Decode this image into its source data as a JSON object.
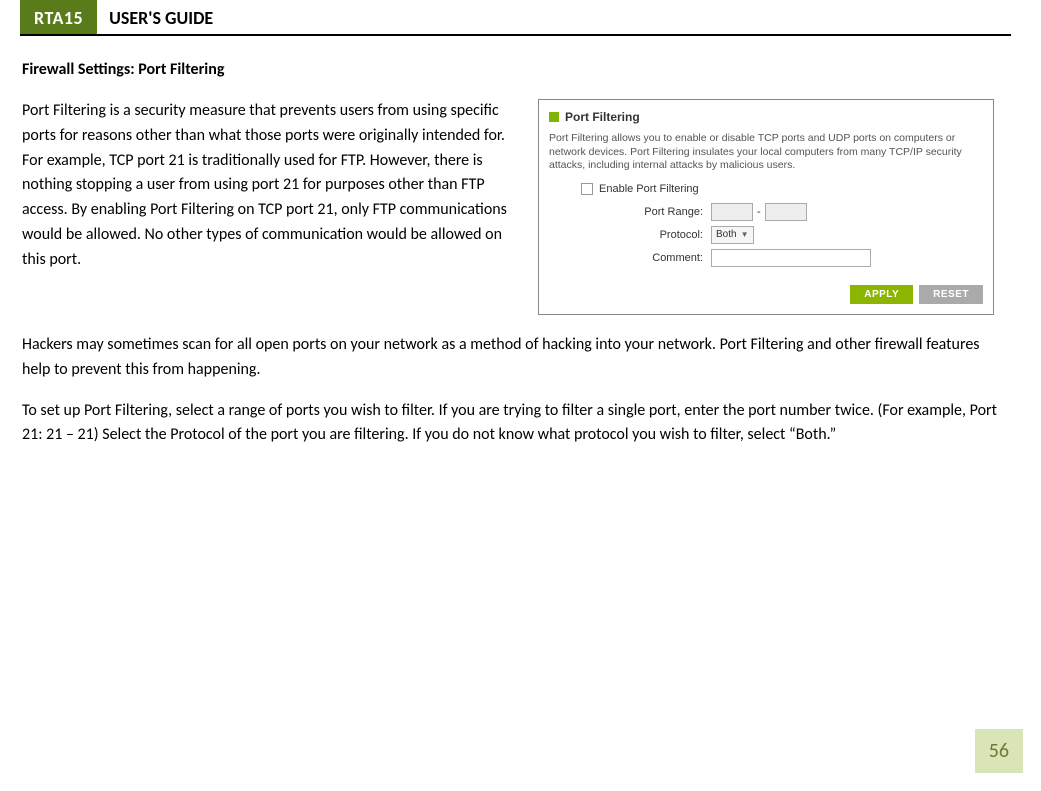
{
  "header": {
    "product": "RTA15",
    "title": "USER'S GUIDE"
  },
  "section_heading": "Firewall Settings: Port Filtering",
  "paragraphs": {
    "p1": "Port Filtering is a security measure that prevents users from using specific ports for reasons other than what those ports were originally intended for.  For example, TCP port 21 is traditionally used for FTP.  However, there is nothing stopping a user from using port 21 for purposes other than FTP access.  By enabling Port Filtering on TCP port 21, only FTP communications would be allowed.  No other types of communication would be allowed on this port.",
    "p2": "Hackers may sometimes scan for all open ports on your network as a method of hacking into your network.  Port Filtering and other firewall features help to prevent this from happening.",
    "p3": "To set up Port Filtering, select a range of ports you wish to filter.  If you are trying to filter a single port, enter the port number twice.  (For example, Port 21:  21 – 21) Select the Protocol of the port you are filtering.  If you do not know what protocol you wish to filter, select “Both.”"
  },
  "panel": {
    "title": "Port Filtering",
    "description": "Port Filtering allows you to enable or disable TCP ports and UDP ports on computers or network devices. Port Filtering insulates your local computers from many TCP/IP security attacks, including internal attacks by malicious users.",
    "enable_label": "Enable Port Filtering",
    "port_range_label": "Port Range:",
    "port_range_dash": "-",
    "protocol_label": "Protocol:",
    "protocol_value": "Both",
    "comment_label": "Comment:",
    "apply_button": "APPLY",
    "reset_button": "RESET"
  },
  "page_number": "56"
}
